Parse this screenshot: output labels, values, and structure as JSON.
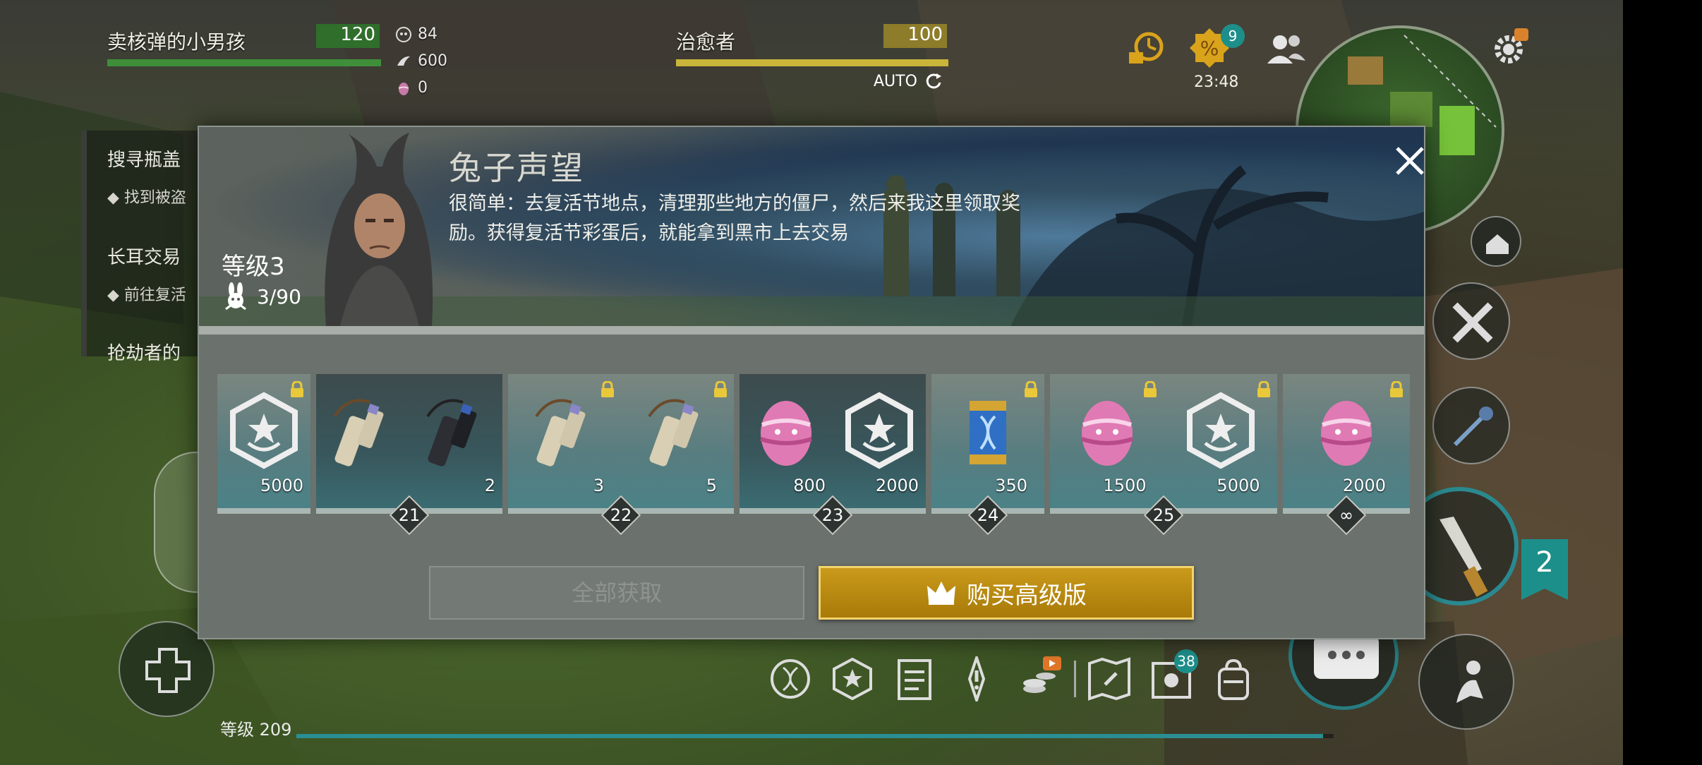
{
  "player": {
    "name": "卖核弹的小男孩",
    "level": "120",
    "resources": [
      {
        "icon": "skull-coin-icon",
        "value": "84"
      },
      {
        "icon": "wing-icon",
        "value": "600"
      },
      {
        "icon": "easter-egg-icon",
        "value": "0"
      }
    ],
    "health_fraction": 1.0
  },
  "companion": {
    "name": "治愈者",
    "level": "100",
    "auto_label": "AUTO",
    "health_fraction": 1.0
  },
  "top_right": {
    "sale_badge": "9",
    "timer": "23:48"
  },
  "quests_bg": [
    {
      "title": "搜寻瓶盖",
      "sub": "找到被盗"
    },
    {
      "title": "长耳交易",
      "sub": "前往复活"
    },
    {
      "title": "抢劫者的"
    }
  ],
  "dialog": {
    "title": "兔子声望",
    "description": "很简单：去复活节地点，清理那些地方的僵尸，然后来我这里领取奖励。获得复活节彩蛋后，就能拿到黑市上去交易",
    "level_label": "等级3",
    "progress": "3/90",
    "rewards": [
      {
        "level": "",
        "claimed": false,
        "slots": [
          {
            "item": "reputation-badge",
            "amount": "5000",
            "locked": true
          }
        ]
      },
      {
        "level": "21",
        "claimed": true,
        "slots": [
          {
            "item": "signal-flare",
            "amount": "",
            "locked": false
          },
          {
            "item": "dark-flare",
            "amount": "2",
            "locked": false
          }
        ]
      },
      {
        "level": "22",
        "claimed": false,
        "slots": [
          {
            "item": "signal-flare",
            "amount": "3",
            "locked": true
          },
          {
            "item": "signal-flare",
            "amount": "5",
            "locked": true
          }
        ]
      },
      {
        "level": "23",
        "claimed": true,
        "slots": [
          {
            "item": "easter-egg",
            "amount": "800",
            "locked": false
          },
          {
            "item": "reputation-badge",
            "amount": "2000",
            "locked": false
          }
        ]
      },
      {
        "level": "24",
        "claimed": false,
        "slots": [
          {
            "item": "dna-capsule",
            "amount": "350",
            "locked": true
          }
        ]
      },
      {
        "level": "25",
        "claimed": false,
        "slots": [
          {
            "item": "easter-egg",
            "amount": "1500",
            "locked": true
          },
          {
            "item": "reputation-badge",
            "amount": "5000",
            "locked": true
          }
        ]
      },
      {
        "level": "∞",
        "claimed": false,
        "slots": [
          {
            "item": "easter-egg",
            "amount": "2000",
            "locked": true
          }
        ]
      }
    ],
    "claim_all_label": "全部获取",
    "premium_label": "购买高级版"
  },
  "bottom": {
    "level_label": "等级 209",
    "xp_fraction": 0.99,
    "inventory_badge": "38",
    "quest_counter": "2"
  },
  "colors": {
    "player_bar": "#3f8f3a",
    "companion_bar": "#c9b53a",
    "premium": "#b8880f",
    "accent_teal": "#1d8f8a"
  }
}
